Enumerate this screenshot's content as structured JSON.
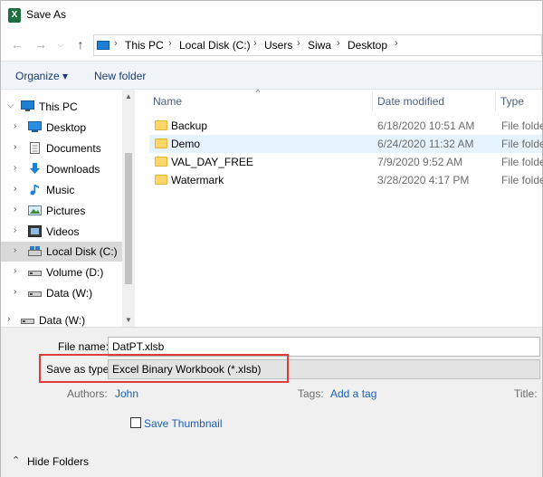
{
  "window": {
    "title": "Save As",
    "app_icon_letter": "X"
  },
  "address": {
    "crumbs": [
      "This PC",
      "Local Disk (C:)",
      "Users",
      "Siwa",
      "Desktop"
    ]
  },
  "toolbar": {
    "organize": "Organize ▾",
    "new_folder": "New folder"
  },
  "navpane": {
    "items": [
      {
        "label": "This PC",
        "icon": "pc-icon"
      },
      {
        "label": "Desktop",
        "icon": "desktop-icon"
      },
      {
        "label": "Documents",
        "icon": "documents-icon"
      },
      {
        "label": "Downloads",
        "icon": "downloads-icon"
      },
      {
        "label": "Music",
        "icon": "music-icon"
      },
      {
        "label": "Pictures",
        "icon": "pictures-icon"
      },
      {
        "label": "Videos",
        "icon": "videos-icon"
      },
      {
        "label": "Local Disk (C:)",
        "icon": "drive-icon",
        "selected": true
      },
      {
        "label": "Volume (D:)",
        "icon": "drive-icon"
      },
      {
        "label": "Data (W:)",
        "icon": "drive-icon"
      },
      {
        "label": "Data (W:)",
        "icon": "drive-icon"
      }
    ]
  },
  "filelist": {
    "columns": {
      "name": "Name",
      "date": "Date modified",
      "type": "Type"
    },
    "rows": [
      {
        "name": "Backup",
        "date": "6/18/2020 10:51 AM",
        "type": "File folde"
      },
      {
        "name": "Demo",
        "date": "6/24/2020 11:32 AM",
        "type": "File folde",
        "selected": true
      },
      {
        "name": "VAL_DAY_FREE",
        "date": "7/9/2020 9:52 AM",
        "type": "File folde"
      },
      {
        "name": "Watermark",
        "date": "3/28/2020 4:17 PM",
        "type": "File folde"
      }
    ]
  },
  "bottom": {
    "file_name_label": "File name:",
    "file_name_value": "DatPT.xlsb",
    "save_type_label": "Save as type:",
    "save_type_value": "Excel Binary Workbook (*.xlsb)",
    "authors_label": "Authors:",
    "authors_value": "John",
    "tags_label": "Tags:",
    "tags_value": "Add a tag",
    "title_label": "Title:",
    "save_thumbnail_label": "Save Thumbnail",
    "hide_folders_label": "Hide Folders"
  },
  "colors": {
    "highlight": "#e03a3a",
    "link": "#1f5fb5",
    "folder": "#ffd769"
  }
}
